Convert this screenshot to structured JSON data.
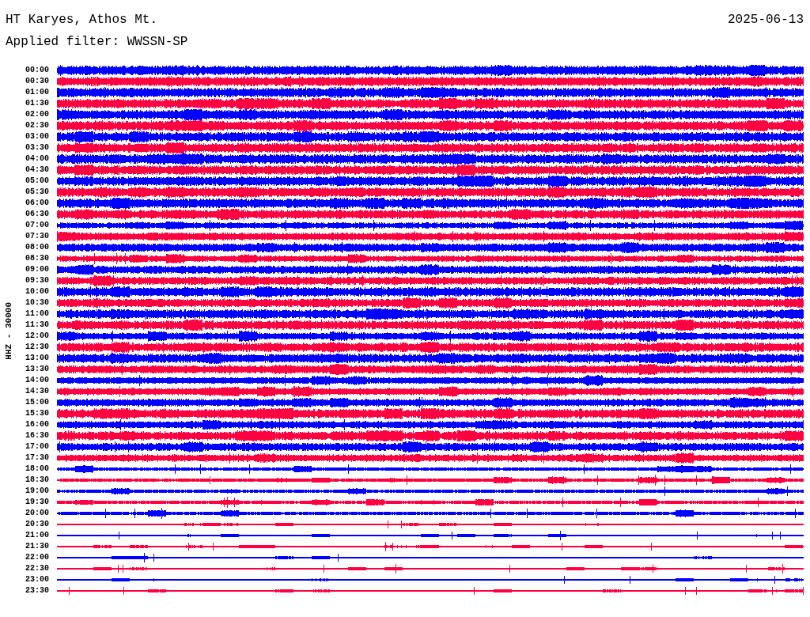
{
  "header": {
    "station": "HT Karyes, Athos Mt.",
    "date": "2025-06-13",
    "filter": "Applied filter: WWSSN-SP"
  },
  "channel_label": "HHZ - 30000",
  "rows": [
    {
      "time": "00:00",
      "color": "#0000ff"
    },
    {
      "time": "00:30",
      "color": "#ff0040"
    },
    {
      "time": "01:00",
      "color": "#0000ff"
    },
    {
      "time": "01:30",
      "color": "#ff0040"
    },
    {
      "time": "02:00",
      "color": "#0000ff"
    },
    {
      "time": "02:30",
      "color": "#ff0040"
    },
    {
      "time": "03:00",
      "color": "#0000ff"
    },
    {
      "time": "03:30",
      "color": "#ff0040"
    },
    {
      "time": "04:00",
      "color": "#0000ff"
    },
    {
      "time": "04:30",
      "color": "#ff0040"
    },
    {
      "time": "05:00",
      "color": "#0000ff"
    },
    {
      "time": "05:30",
      "color": "#ff0040"
    },
    {
      "time": "06:00",
      "color": "#0000ff"
    },
    {
      "time": "06:30",
      "color": "#ff0040"
    },
    {
      "time": "07:00",
      "color": "#0000ff"
    },
    {
      "time": "07:30",
      "color": "#ff0040"
    },
    {
      "time": "08:00",
      "color": "#0000ff"
    },
    {
      "time": "08:30",
      "color": "#ff0040"
    },
    {
      "time": "09:00",
      "color": "#0000ff"
    },
    {
      "time": "09:30",
      "color": "#ff0040"
    },
    {
      "time": "10:00",
      "color": "#0000ff"
    },
    {
      "time": "10:30",
      "color": "#ff0040"
    },
    {
      "time": "11:00",
      "color": "#0000ff"
    },
    {
      "time": "11:30",
      "color": "#ff0040"
    },
    {
      "time": "12:00",
      "color": "#0000ff"
    },
    {
      "time": "12:30",
      "color": "#ff0040"
    },
    {
      "time": "13:00",
      "color": "#0000ff"
    },
    {
      "time": "13:30",
      "color": "#ff0040"
    },
    {
      "time": "14:00",
      "color": "#0000ff"
    },
    {
      "time": "14:30",
      "color": "#ff0040"
    },
    {
      "time": "15:00",
      "color": "#0000ff"
    },
    {
      "time": "15:30",
      "color": "#ff0040"
    },
    {
      "time": "16:00",
      "color": "#0000ff"
    },
    {
      "time": "16:30",
      "color": "#ff0040"
    },
    {
      "time": "17:00",
      "color": "#0000ff"
    },
    {
      "time": "17:30",
      "color": "#ff0040"
    },
    {
      "time": "18:00",
      "color": "#0000ff"
    },
    {
      "time": "18:30",
      "color": "#ff0040"
    },
    {
      "time": "19:00",
      "color": "#0000ff"
    },
    {
      "time": "19:30",
      "color": "#ff0040"
    },
    {
      "time": "20:00",
      "color": "#0000ff"
    },
    {
      "time": "20:30",
      "color": "#ff0040"
    },
    {
      "time": "21:00",
      "color": "#0000ff"
    },
    {
      "time": "21:30",
      "color": "#ff0040"
    },
    {
      "time": "22:00",
      "color": "#0000ff"
    },
    {
      "time": "22:30",
      "color": "#ff0040"
    },
    {
      "time": "23:00",
      "color": "#0000ff"
    },
    {
      "time": "23:30",
      "color": "#ff0040"
    }
  ]
}
